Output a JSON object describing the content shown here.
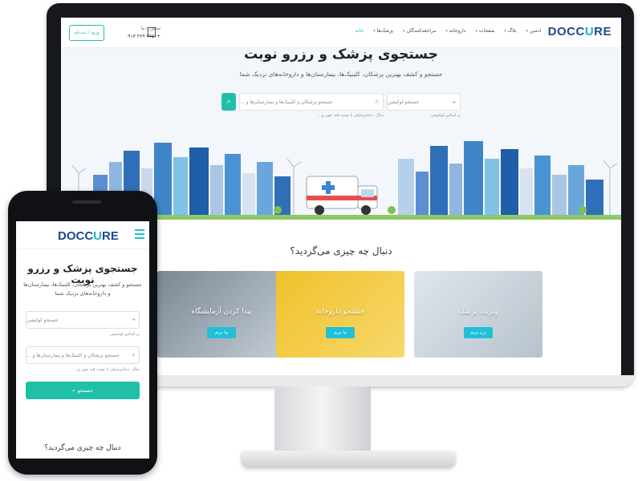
{
  "desktop": {
    "logo": {
      "text_a": "DOCC",
      "text_u": "U",
      "text_b": "RE"
    },
    "nav": [
      {
        "label": "خانه"
      },
      {
        "label": "پزشک‌ها"
      },
      {
        "label": "مراجعه‌کنندگان"
      },
      {
        "label": "داروخانه"
      },
      {
        "label": "صفحات"
      },
      {
        "label": "بلاگ"
      },
      {
        "label": "ادمین"
      }
    ],
    "contact": {
      "label": "تماس با ما",
      "phone": "۰۹۱۳ ۳۶۹ ۳۷۵۱+"
    },
    "login_label": "ورود / ثبت‌نام",
    "hero": {
      "title": "جستجوی پزشک و رزرو نوبت",
      "subtitle": "جستجو و کشف بهترین پزشکان، کلینیک‌ها، بیمارستان‌ها و داروخانه‌های نزدیک شما",
      "location_placeholder": "جستجو لوکیشن",
      "location_hint": "بر اساس لوکیشن",
      "query_placeholder": "جستجو پزشکان و کلینیک‌ها و بیمارستان‌ها و ...",
      "query_hint": "مثال: دندانپزشکی یا تست قند خون و..."
    },
    "section_title": "دنبال چه چیزی می‌گردید؟",
    "cards": [
      {
        "label": "پیدا کردن آزمایشگاه",
        "button": "بیا بریم",
        "color": "#9aa7b5"
      },
      {
        "label": "جستجو داروخانه",
        "button": "بیا بریم",
        "color": "#f2c63a"
      },
      {
        "label": "ویزیت پزشک",
        "button": "بزن بریم",
        "color": "#dfe6ec"
      }
    ]
  },
  "mobile": {
    "logo": {
      "text_a": "DOCC",
      "text_u": "U",
      "text_b": "RE"
    },
    "title": "جستجوی پزشک و رزرو نوبت",
    "subtitle": "جستجو و کشف بهترین پزشکان، کلینیک‌ها، بیمارستان‌ها و داروخانه‌های نزدیک شما",
    "location_placeholder": "جستجو لوکیشن",
    "location_hint": "بر اساس لوکیشن",
    "query_placeholder": "جستجو پزشکان و کلینیک‌ها و بیمارستان‌ها و ...",
    "query_hint": "مثال: دندانپزشکی یا تست قند خون و...",
    "search_button": "جستجو",
    "section_title": "دنبال چه چیزی می‌گردید؟"
  },
  "colors": {
    "accent": "#20c0a8",
    "brand": "#1c4b8f",
    "brand_light": "#1fb3c9"
  },
  "icons": [
    "location-pin-icon",
    "search-icon",
    "hamburger-menu-icon",
    "hospital-icon",
    "chevron-down-icon"
  ]
}
